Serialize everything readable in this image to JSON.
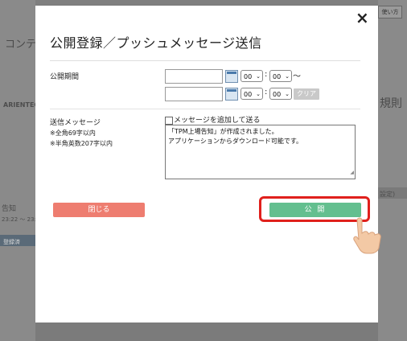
{
  "background": {
    "left_heading": "コンテ",
    "left_logo": "ARIENTEC",
    "left_section": "告知",
    "left_time": "23:22 ～ 23:",
    "left_button": "登録済",
    "right_heading": "規則",
    "right_tab": "使い方",
    "right_badge": "設定)"
  },
  "modal": {
    "close_label": "×",
    "title": "公開登録／プッシュメッセージ送信",
    "period": {
      "label": "公開期間",
      "start_date": "",
      "start_hour": "00",
      "start_min": "00",
      "tilde": "～",
      "end_date": "",
      "end_hour": "00",
      "end_min": "00",
      "clear_label": "クリア"
    },
    "message": {
      "label": "送信メッセージ",
      "note1": "※全角69字以内",
      "note2": "※半角英数207字以内",
      "checkbox_label": "メッセージを追加して送る",
      "line1": "「TPM上場告知」が作成されました。",
      "line2": "アプリケーションからダウンロード可能です。"
    },
    "close_button": "閉じる",
    "publish_button": "公 開"
  },
  "colors": {
    "close_button": "#ee7d70",
    "publish_button": "#63bf8f",
    "highlight": "#e0201c"
  }
}
